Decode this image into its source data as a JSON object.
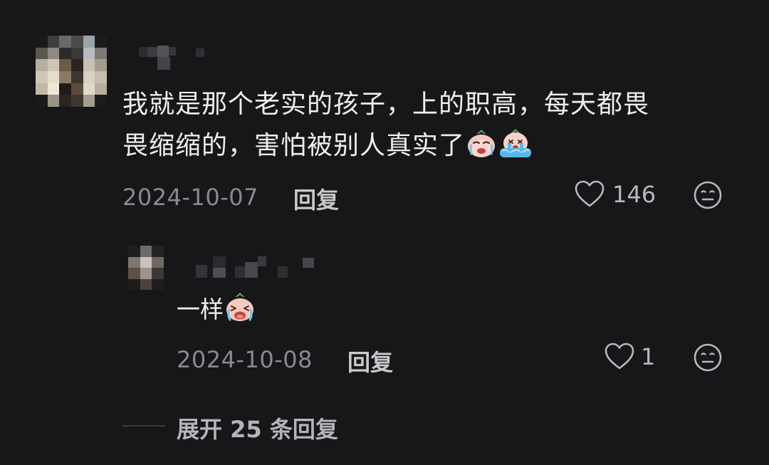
{
  "colors": {
    "background": "#17171a",
    "primary_text": "#eeeeee",
    "secondary_text": "#8a8a8e",
    "action_text": "#c9c9cc"
  },
  "comment": {
    "avatar": "blurred-user-avatar",
    "username_hidden": true,
    "text_line1": "我就是那个老实的孩子，上的职高，每天都畏",
    "text_line2": "畏缩缩的，害怕被别人真实了",
    "emojis": [
      "crying-face-emoji",
      "sobbing-tears-emoji"
    ],
    "date": "2024-10-07",
    "reply_label": "回复",
    "like_icon": "heart-outline-icon",
    "like_count": "146",
    "dislike_icon": "meh-face-icon"
  },
  "reply": {
    "avatar": "blurred-user-avatar",
    "username_hidden": true,
    "text": "一样",
    "emojis": [
      "crying-face-emoji"
    ],
    "date": "2024-10-08",
    "reply_label": "回复",
    "like_icon": "heart-outline-icon",
    "like_count": "1",
    "dislike_icon": "meh-face-icon"
  },
  "expand_replies": {
    "label": "展开 25 条回复"
  }
}
